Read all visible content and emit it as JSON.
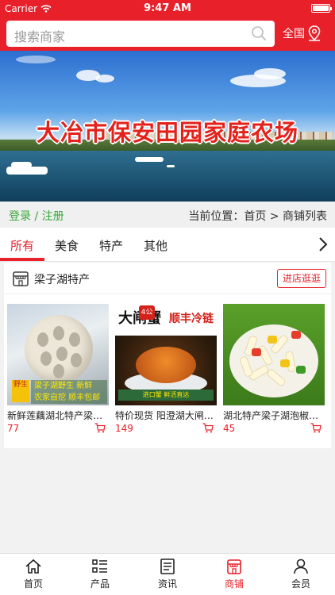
{
  "status": {
    "carrier": "Carrier",
    "time": "9:47 AM"
  },
  "search": {
    "placeholder": "搜索商家",
    "region": "全国"
  },
  "banner": {
    "title": "大冶市保安田园家庭农场"
  },
  "breadcrumb": {
    "login": "登录 / 注册",
    "location": "当前位置：首页 > 商铺列表"
  },
  "tabs": [
    {
      "label": "所有",
      "active": true
    },
    {
      "label": "美食"
    },
    {
      "label": "特产"
    },
    {
      "label": "其他"
    }
  ],
  "shop": {
    "name": "梁子湖特产",
    "enter_label": "进店逛逛",
    "products": [
      {
        "title": "新鲜莲藕湖北特产梁子湖...",
        "price": "77",
        "image_text": {
          "tag": "野生",
          "caption_1": "梁子湖野生 新鲜",
          "caption_2": "农家自挖 顺丰包邮"
        }
      },
      {
        "title": "特价现货 阳澄湖大闸蟹...",
        "price": "149",
        "image_text": {
          "t1": "大闸蟹",
          "t2": "顺丰冷链",
          "badge": "4公",
          "bottom": "进口蟹 鲜活直达"
        }
      },
      {
        "title": "湖北特产梁子湖泡椒藕带...",
        "price": "45"
      }
    ]
  },
  "tabbar": [
    {
      "label": "首页",
      "icon": "home-icon"
    },
    {
      "label": "产品",
      "icon": "list-icon"
    },
    {
      "label": "资讯",
      "icon": "news-icon"
    },
    {
      "label": "商铺",
      "icon": "store-icon",
      "active": true
    },
    {
      "label": "会员",
      "icon": "user-icon"
    }
  ],
  "colors": {
    "brand": "#e8202a",
    "login": "#3aa63a"
  }
}
